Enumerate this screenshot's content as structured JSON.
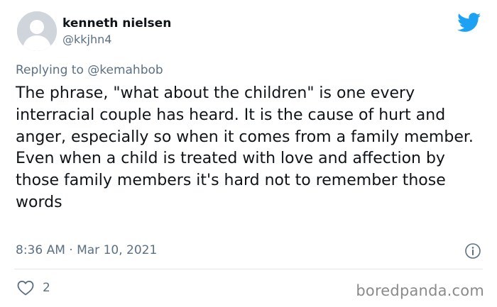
{
  "author": {
    "display_name": "kenneth nielsen",
    "handle": "@kkjhn4",
    "avatar_icon": "default-profile-icon"
  },
  "brand": {
    "icon": "twitter-bird-icon",
    "color": "#1da1f2"
  },
  "reply": {
    "prefix": "Replying to",
    "mention": "@kemahbob"
  },
  "tweet": {
    "paragraphs": [
      "The phrase, \"what about the children\" is one every interracial couple has heard. It is the cause of hurt and anger, especially so when it comes from a family member.",
      "Even when a child is treated with love and affection by those family members it's hard not to remember those words"
    ]
  },
  "meta": {
    "timestamp": "8:36 AM · Mar 10, 2021",
    "info_icon": "info-icon"
  },
  "engagement": {
    "like_icon": "heart-icon",
    "likes": "2"
  },
  "watermark": "boredpanda.com",
  "colors": {
    "text": "#0f1419",
    "secondary": "#5b7083",
    "divider": "#e1e8ed",
    "avatar_bg": "#cfd5db"
  }
}
